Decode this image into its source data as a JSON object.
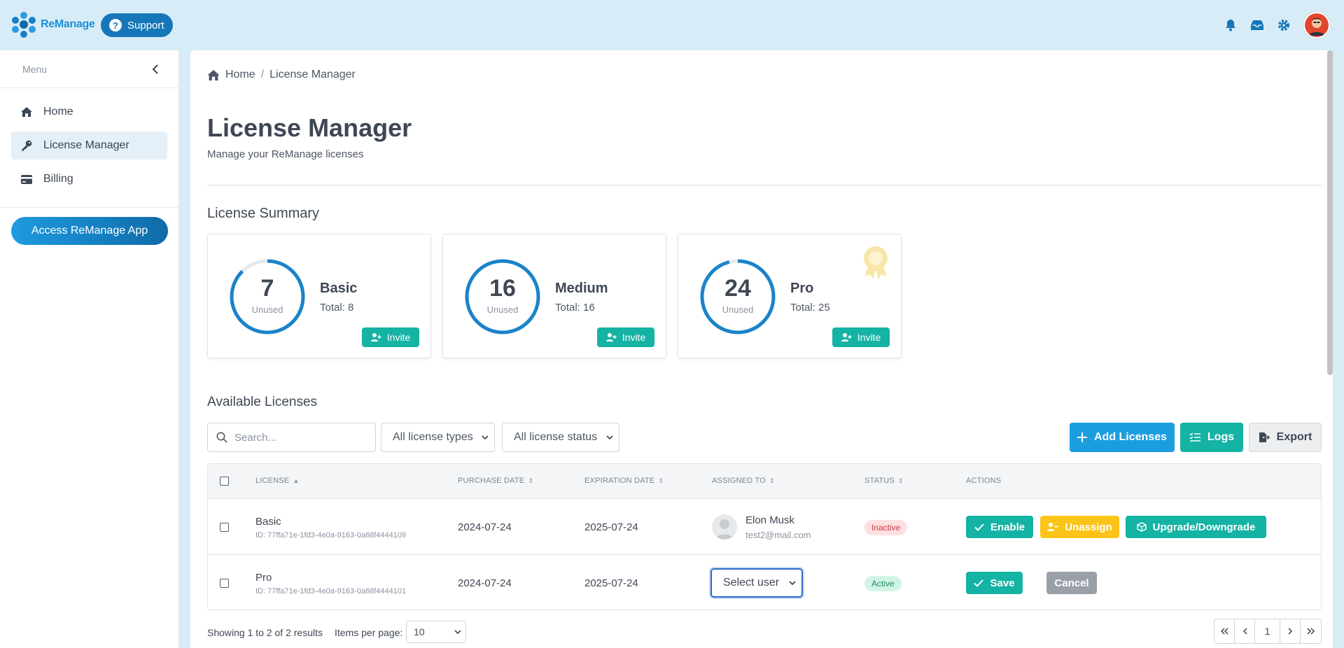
{
  "header": {
    "app_name": "ReManage",
    "support_label": "Support",
    "support_icon": "?"
  },
  "sidebar": {
    "menu_label": "Menu",
    "items": [
      {
        "label": "Home",
        "icon": "home-icon"
      },
      {
        "label": "License Manager",
        "icon": "key-icon",
        "active": true
      },
      {
        "label": "Billing",
        "icon": "credit-card-icon"
      }
    ],
    "access_button": "Access ReManage App"
  },
  "breadcrumb": {
    "home": "Home",
    "sep": "/",
    "current": "License Manager"
  },
  "page": {
    "title": "License Manager",
    "subtitle": "Manage your ReManage licenses"
  },
  "summary": {
    "title": "License Summary",
    "cards": [
      {
        "count": "7",
        "count_label": "Unused",
        "name": "Basic",
        "total": "Total: 8",
        "invite": "Invite",
        "fill_fraction": 0.875
      },
      {
        "count": "16",
        "count_label": "Unused",
        "name": "Medium",
        "total": "Total: 16",
        "invite": "Invite",
        "fill_fraction": 1.0
      },
      {
        "count": "24",
        "count_label": "Unused",
        "name": "Pro",
        "total": "Total: 25",
        "invite": "Invite",
        "fill_fraction": 0.96
      }
    ]
  },
  "available": {
    "title": "Available Licenses",
    "search_placeholder": "Search...",
    "type_filter": "All license types",
    "status_filter": "All license status",
    "add_label": "Add Licenses",
    "logs_label": "Logs",
    "export_label": "Export"
  },
  "table": {
    "columns": [
      "LICENSE",
      "PURCHASE DATE",
      "EXPIRATION DATE",
      "ASSIGNED TO",
      "STATUS",
      "ACTIONS"
    ],
    "rows": [
      {
        "name": "Basic",
        "id": "ID: 77ffa71e-1fd3-4e0a-9163-0a68f4444109",
        "purchase": "2024-07-24",
        "expiration": "2025-07-24",
        "user_name": "Elon Musk",
        "user_email": "test2@mail.com",
        "status": "Inactive",
        "actions": [
          "Enable",
          "Unassign",
          "Upgrade/Downgrade"
        ]
      },
      {
        "name": "Pro",
        "id": "ID: 77ffa71e-1fd3-4e0a-9163-0a68f4444101",
        "purchase": "2024-07-24",
        "expiration": "2025-07-24",
        "select_user": "Select user",
        "status": "Active",
        "actions": [
          "Save",
          "Cancel"
        ]
      }
    ]
  },
  "footer": {
    "showing": "Showing 1 to 2 of 2 results",
    "items_per_page_label": "Items per page:",
    "items_per_page": "10",
    "current_page": "1"
  },
  "colors": {
    "primary": "#1a8fd8",
    "teal": "#14b3a4",
    "yellow": "#fcc419",
    "gray_btn": "#9aa0a8"
  }
}
